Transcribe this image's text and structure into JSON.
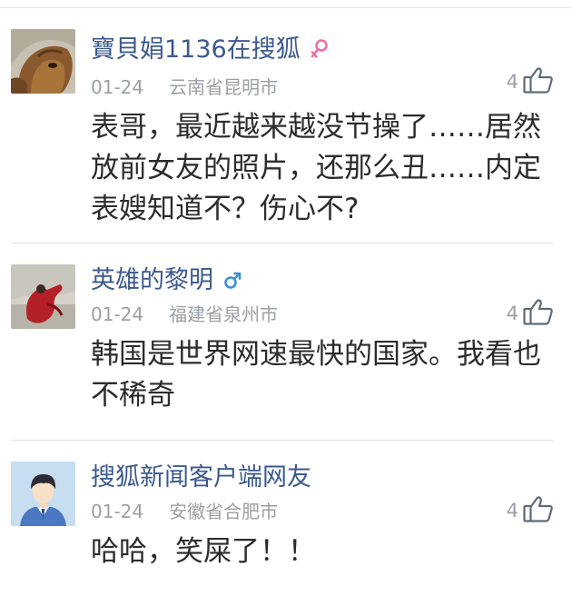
{
  "comments": [
    {
      "user": "寶貝娟1136在搜狐",
      "gender": "female",
      "gender_icon": "female-symbol-icon",
      "avatar_icon": "lion-photo-avatar",
      "date": "01-24",
      "location": "云南省昆明市",
      "likes": "4",
      "text": "表哥，最近越来越没节操了……居然放前女友的照片，还那么丑……内定表嫂知道不？伤心不?"
    },
    {
      "user": "英雄的黎明",
      "gender": "male",
      "gender_icon": "male-symbol-icon",
      "avatar_icon": "red-figure-photo-avatar",
      "date": "01-24",
      "location": "福建省泉州市",
      "likes": "4",
      "text": "韩国是世界网速最快的国家。我看也不稀奇"
    },
    {
      "user": "搜狐新闻客户端网友",
      "gender": "",
      "avatar_icon": "default-user-avatar",
      "date": "01-24",
      "location": "安徽省合肥市",
      "likes": "4",
      "text": "哈哈，笑屎了！！"
    }
  ],
  "colors": {
    "username": "#3c5a8c",
    "meta": "#9aa0a6",
    "body_text": "#2c2c2c",
    "female_icon": "#f06fa8",
    "male_icon": "#3d8fd6",
    "divider": "#e2e2e2"
  },
  "like_icon": "thumbs-up-icon"
}
